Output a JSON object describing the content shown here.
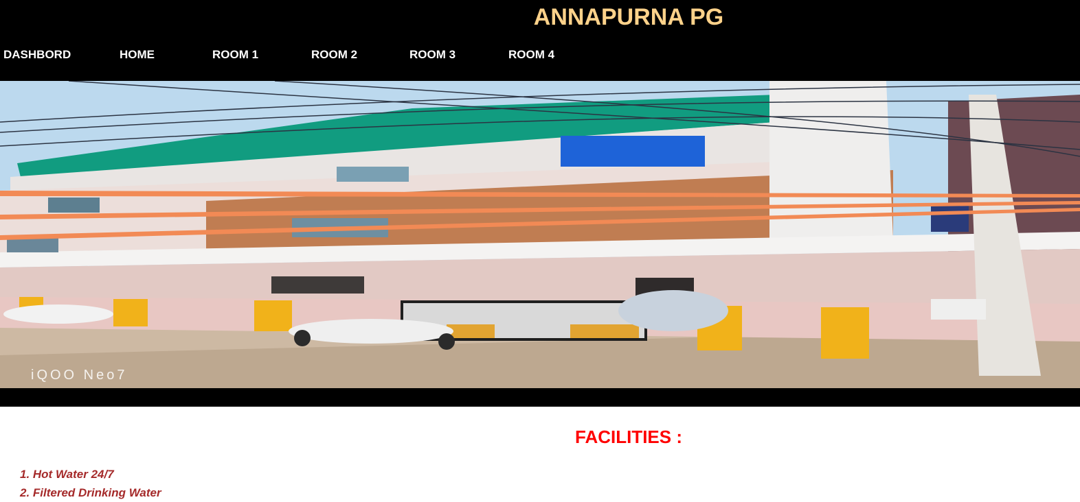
{
  "site": {
    "title": "ANNAPURNA PG"
  },
  "nav": [
    {
      "label": "DASHBORD"
    },
    {
      "label": "HOME"
    },
    {
      "label": "ROOM 1"
    },
    {
      "label": "ROOM 2"
    },
    {
      "label": "ROOM 3"
    },
    {
      "label": "ROOM 4"
    }
  ],
  "hero": {
    "watermark": "iQOO Neo7"
  },
  "facilities": {
    "title": "FACILITIES :",
    "items": [
      "1. Hot Water 24/7",
      "2. Filtered Drinking Water"
    ]
  }
}
